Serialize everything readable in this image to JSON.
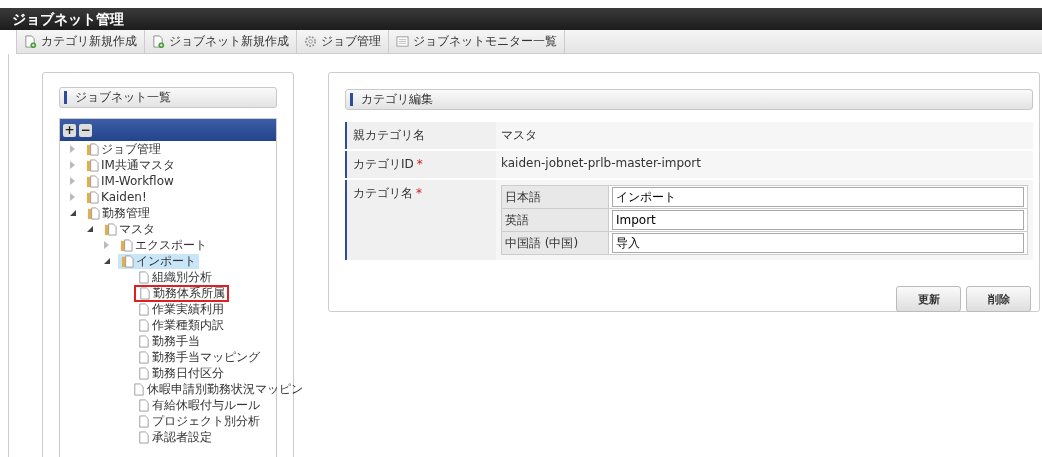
{
  "window": {
    "title": "ジョブネット管理"
  },
  "toolbar": [
    {
      "kind": "new-category",
      "label": "カテゴリ新規作成"
    },
    {
      "kind": "new-jobnet",
      "label": "ジョブネット新規作成"
    },
    {
      "kind": "gear",
      "label": "ジョブ管理"
    },
    {
      "kind": "list",
      "label": "ジョブネットモニター一覧"
    }
  ],
  "left_panel": {
    "title": "ジョブネット一覧",
    "tree_buttons": [
      "+",
      "−"
    ],
    "tree": [
      {
        "label": "ジョブ管理",
        "kind": "folder",
        "expanded": false,
        "selected": false,
        "highlighted": false
      },
      {
        "label": "IM共通マスタ",
        "kind": "folder",
        "expanded": false,
        "selected": false,
        "highlighted": false
      },
      {
        "label": "IM-Workflow",
        "kind": "folder",
        "expanded": false,
        "selected": false,
        "highlighted": false
      },
      {
        "label": "Kaiden!",
        "kind": "folder",
        "expanded": false,
        "selected": false,
        "highlighted": false
      },
      {
        "label": "勤務管理",
        "kind": "folder",
        "expanded": true,
        "selected": false,
        "highlighted": false,
        "children": [
          {
            "label": "マスタ",
            "kind": "folder",
            "expanded": true,
            "selected": false,
            "highlighted": false,
            "children": [
              {
                "label": "エクスポート",
                "kind": "folder",
                "expanded": false,
                "selected": false,
                "highlighted": false
              },
              {
                "label": "インポート",
                "kind": "folder",
                "expanded": true,
                "selected": true,
                "highlighted": false,
                "children": [
                  {
                    "label": "組織別分析",
                    "kind": "file",
                    "selected": false,
                    "highlighted": false
                  },
                  {
                    "label": "勤務体系所属",
                    "kind": "file",
                    "selected": false,
                    "highlighted": true
                  },
                  {
                    "label": "作業実績利用",
                    "kind": "file",
                    "selected": false,
                    "highlighted": false
                  },
                  {
                    "label": "作業種類内訳",
                    "kind": "file",
                    "selected": false,
                    "highlighted": false
                  },
                  {
                    "label": "勤務手当",
                    "kind": "file",
                    "selected": false,
                    "highlighted": false
                  },
                  {
                    "label": "勤務手当マッピング",
                    "kind": "file",
                    "selected": false,
                    "highlighted": false
                  },
                  {
                    "label": "勤務日付区分",
                    "kind": "file",
                    "selected": false,
                    "highlighted": false
                  },
                  {
                    "label": "休暇申請別勤務状況マッピン",
                    "kind": "file",
                    "selected": false,
                    "highlighted": false
                  },
                  {
                    "label": "有給休暇付与ルール",
                    "kind": "file",
                    "selected": false,
                    "highlighted": false
                  },
                  {
                    "label": "プロジェクト別分析",
                    "kind": "file",
                    "selected": false,
                    "highlighted": false
                  },
                  {
                    "label": "承認者設定",
                    "kind": "file",
                    "selected": false,
                    "highlighted": false
                  }
                ]
              }
            ]
          }
        ]
      }
    ]
  },
  "right_panel": {
    "title": "カテゴリ編集",
    "fields": [
      {
        "label": "親カテゴリ名",
        "required": false,
        "value": "マスタ"
      },
      {
        "label": "カテゴリID",
        "required": true,
        "value": "kaiden-jobnet-prlb-master-import"
      }
    ],
    "name_field": {
      "label": "カテゴリ名",
      "required": true,
      "required_mark": "*",
      "locales": [
        {
          "label": "日本語",
          "value": "インポート"
        },
        {
          "label": "英語",
          "value": "Import"
        },
        {
          "label": "中国語 (中国)",
          "value": "导入"
        }
      ]
    },
    "buttons": [
      "更新",
      "削除"
    ]
  }
}
